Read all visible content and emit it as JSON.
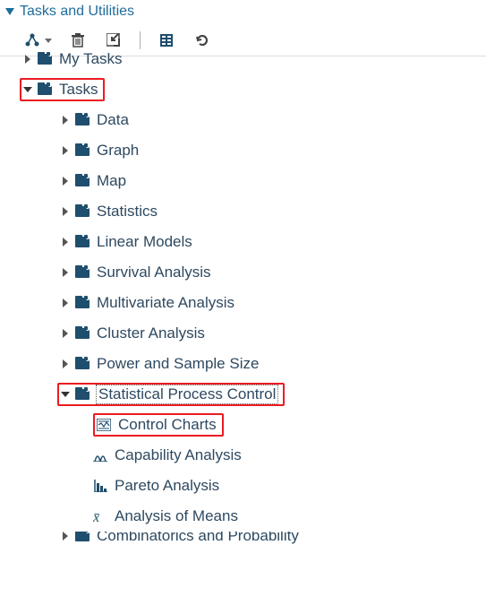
{
  "panel": {
    "title": "Tasks and Utilities"
  },
  "toolbar": {
    "btn1": "new-task-button",
    "btn2": "delete-button",
    "btn3": "open-button",
    "btn4": "properties-button",
    "btn5": "refresh-button"
  },
  "tree": {
    "my_tasks": "My Tasks",
    "tasks": "Tasks",
    "items": {
      "data": "Data",
      "graph": "Graph",
      "map": "Map",
      "statistics": "Statistics",
      "linear_models": "Linear Models",
      "survival_analysis": "Survival Analysis",
      "multivariate_analysis": "Multivariate Analysis",
      "cluster_analysis": "Cluster Analysis",
      "power_sample": "Power and Sample Size",
      "spc": "Statistical Process Control",
      "spc_children": {
        "control_charts": "Control Charts",
        "capability": "Capability Analysis",
        "pareto": "Pareto Analysis",
        "means": "Analysis of Means"
      },
      "combinatorics": "Combinatorics and Probability"
    }
  }
}
